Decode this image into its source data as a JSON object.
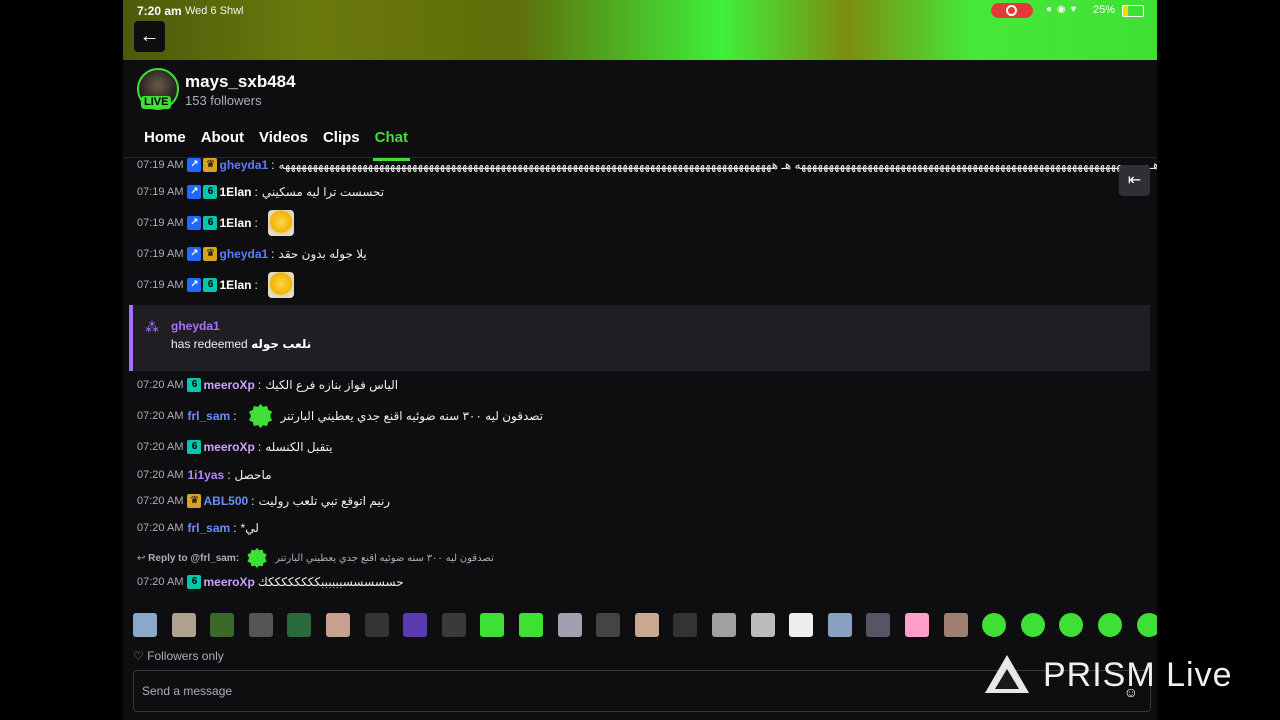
{
  "status_bar": {
    "time": "7:20 am",
    "date": "Wed 6 Shwl",
    "battery": "25%",
    "battery_level": 0.25
  },
  "channel": {
    "username": "mays_sxb484",
    "followers": "153 followers",
    "live_label": "LIVE"
  },
  "tabs": [
    {
      "label": "Home",
      "active": false
    },
    {
      "label": "About",
      "active": false
    },
    {
      "label": "Videos",
      "active": false
    },
    {
      "label": "Clips",
      "active": false
    },
    {
      "label": "Chat",
      "active": true
    }
  ],
  "colors": {
    "accent": "#3fe036",
    "purple": "#a970ff",
    "blue_user": "#1f69ff"
  },
  "messages": [
    {
      "time": "07:19 AM",
      "user": "gheyda1",
      "color": "#5c7cfa",
      "badges": [
        "pin",
        "crown"
      ],
      "text": "هـهههههههههههههههههههههههههههههههههههههههههههههههههههههههههههههههه هـ هههههههههههههههههههههههههههههههههههههههههههههههههههههههههههههههههههههههههههههههههههههههههه"
    },
    {
      "time": "07:19 AM",
      "user": "1Elan",
      "color": "#ffffff",
      "badges": [
        "pin",
        "sub"
      ],
      "text": "تحسست ترا ليه مسكيني"
    },
    {
      "time": "07:19 AM",
      "user": "1Elan",
      "color": "#ffffff",
      "badges": [
        "pin",
        "sub"
      ],
      "text": "",
      "emote": true
    },
    {
      "time": "07:19 AM",
      "user": "gheyda1",
      "color": "#5c7cfa",
      "badges": [
        "pin",
        "crown"
      ],
      "text": "يلا جوله بدون حقد"
    },
    {
      "time": "07:19 AM",
      "user": "1Elan",
      "color": "#ffffff",
      "badges": [
        "pin",
        "sub"
      ],
      "text": "",
      "emote": true
    }
  ],
  "redemption": {
    "user": "gheyda1",
    "prefix": "has redeemed",
    "reward": "نلعب جوله"
  },
  "messages2": [
    {
      "time": "07:20 AM",
      "user": "meeroXp",
      "color": "#c9a3ff",
      "badges": [
        "sub"
      ],
      "text": "الياس فواز بنازه فرع الكيك"
    },
    {
      "time": "07:20 AM",
      "user": "frl_sam",
      "color": "#6b8dff",
      "badges": [],
      "text": "تصدقون ليه ٣٠٠ سنه ضوئيه اقنع جدي يعطيني البارتنر",
      "check": true
    },
    {
      "time": "07:20 AM",
      "user": "meeroXp",
      "color": "#c9a3ff",
      "badges": [
        "sub"
      ],
      "text": "يتقبل الكنسله"
    },
    {
      "time": "07:20 AM",
      "user": "1i1yas",
      "color": "#b388ff",
      "badges": [],
      "text": "ماحصل"
    },
    {
      "time": "07:20 AM",
      "user": "ABL500",
      "color": "#6b8dff",
      "badges": [
        "crown"
      ],
      "text": "رنيم اتوقع تبي تلعب روليت"
    },
    {
      "time": "07:20 AM",
      "user": "frl_sam",
      "color": "#6b8dff",
      "badges": [],
      "text": "لي*"
    }
  ],
  "reply": {
    "label": "Reply to @frl_sam:",
    "quoted": "تصدقون ليه ٣٠٠ سنه ضوئيه اقنع جدي يعطيني البارتنر"
  },
  "last_message": {
    "time": "07:20 AM",
    "user": "meeroXp",
    "color": "#c9a3ff",
    "text": "حسسسسسببببببككككككككك"
  },
  "followers_only": "Followers only",
  "input": {
    "placeholder": "Send a message"
  },
  "watermark": {
    "brand": "PRISM",
    "suffix": "Live"
  }
}
